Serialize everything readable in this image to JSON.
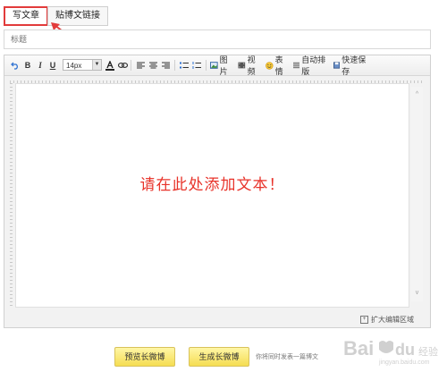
{
  "tabs": [
    {
      "label": "写文章",
      "active": true
    },
    {
      "label": "贴博文链接",
      "active": false
    }
  ],
  "title_field": {
    "placeholder": "标题",
    "value": ""
  },
  "toolbar": {
    "font_size": "14px",
    "bold": "B",
    "italic": "I",
    "underline": "U",
    "image_label": "图片",
    "video_label": "视频",
    "emoji_label": "表情",
    "autolayout_label": "自动排版",
    "quicksave_label": "快速保存"
  },
  "editor": {
    "placeholder": "请在此处添加文本！",
    "expand_label": "扩大编辑区域"
  },
  "buttons": {
    "preview": "预览长微博",
    "generate": "生成长微博"
  },
  "hint": "你将同时发表一篇博文",
  "watermark": {
    "text": "Bai du 经验",
    "url": "jingyan.baidu.com"
  },
  "colors": {
    "active_tab_border": "#e23b3b",
    "placeholder_text": "#e8332a",
    "button": "#f5dd52"
  }
}
